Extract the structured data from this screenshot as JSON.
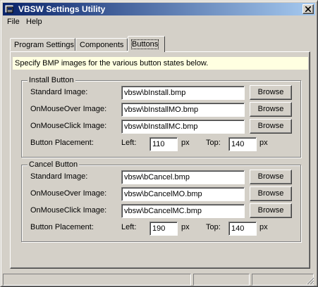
{
  "window": {
    "title": "VBSW Settings Utility"
  },
  "menu": {
    "file": "File",
    "help": "Help"
  },
  "tabs": [
    "Program Settings",
    "Components",
    "Buttons"
  ],
  "info_text": "Specify BMP images for the various button states below.",
  "install": {
    "legend": "Install Button",
    "standard_label": "Standard Image:",
    "mouseover_label": "OnMouseOver Image:",
    "mouseclick_label": "OnMouseClick Image:",
    "placement_label": "Button Placement:",
    "standard_value": "vbsw\\bInstall.bmp",
    "mouseover_value": "vbsw\\bInstallMO.bmp",
    "mouseclick_value": "vbsw\\bInstallMC.bmp",
    "left_label": "Left:",
    "left_value": "110",
    "top_label": "Top:",
    "top_value": "140",
    "unit": "px",
    "browse": "Browse"
  },
  "cancel": {
    "legend": "Cancel Button",
    "standard_label": "Standard Image:",
    "mouseover_label": "OnMouseOver Image:",
    "mouseclick_label": "OnMouseClick Image:",
    "placement_label": "Button Placement:",
    "standard_value": "vbsw\\bCancel.bmp",
    "mouseover_value": "vbsw\\bCancelMO.bmp",
    "mouseclick_value": "vbsw\\bCancelMC.bmp",
    "left_label": "Left:",
    "left_value": "190",
    "top_label": "Top:",
    "top_value": "140",
    "unit": "px",
    "browse": "Browse"
  },
  "colors": {
    "titlebar_start": "#0a246a",
    "titlebar_end": "#a6caf0",
    "info_bg": "#ffffe1",
    "face": "#d4d0c8"
  }
}
